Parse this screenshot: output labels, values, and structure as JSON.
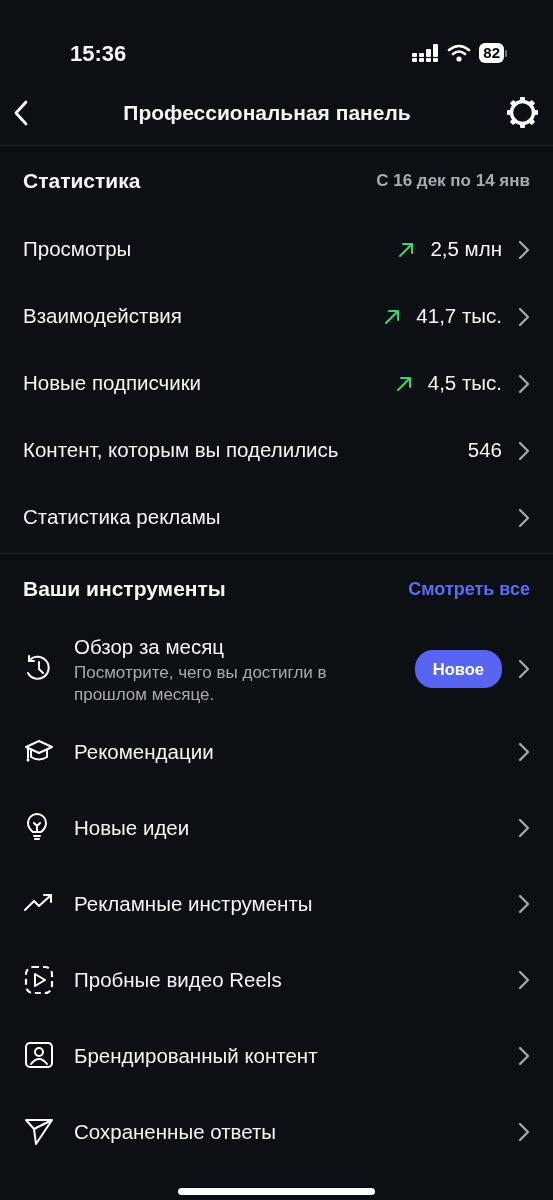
{
  "status_bar": {
    "time": "15:36",
    "battery": "82"
  },
  "header": {
    "title": "Профессиональная панель"
  },
  "statistics": {
    "title": "Статистика",
    "period": "С 16 дек по 14 янв",
    "rows": [
      {
        "label": "Просмотры",
        "value": "2,5 млн",
        "trend_up": true
      },
      {
        "label": "Взаимодействия",
        "value": "41,7 тыс.",
        "trend_up": true
      },
      {
        "label": "Новые подписчики",
        "value": "4,5 тыс.",
        "trend_up": true
      },
      {
        "label": "Контент, которым вы поделились",
        "value": "546",
        "trend_up": false
      },
      {
        "label": "Статистика рекламы",
        "trend_up": false
      }
    ]
  },
  "tools": {
    "title": "Ваши инструменты",
    "see_all": "Смотреть все",
    "items": [
      {
        "kind": "history",
        "label": "Обзор за месяц",
        "description": "Посмотрите, чего вы достигли в прошлом месяце.",
        "badge": "Новое"
      },
      {
        "kind": "cap",
        "label": "Рекомендации"
      },
      {
        "kind": "bulb",
        "label": "Новые идеи"
      },
      {
        "kind": "trend",
        "label": "Рекламные инструменты"
      },
      {
        "kind": "reels",
        "label": "Пробные видео Reels"
      },
      {
        "kind": "branded",
        "label": "Брендированный контент"
      },
      {
        "kind": "send",
        "label": "Сохраненные ответы"
      }
    ]
  }
}
